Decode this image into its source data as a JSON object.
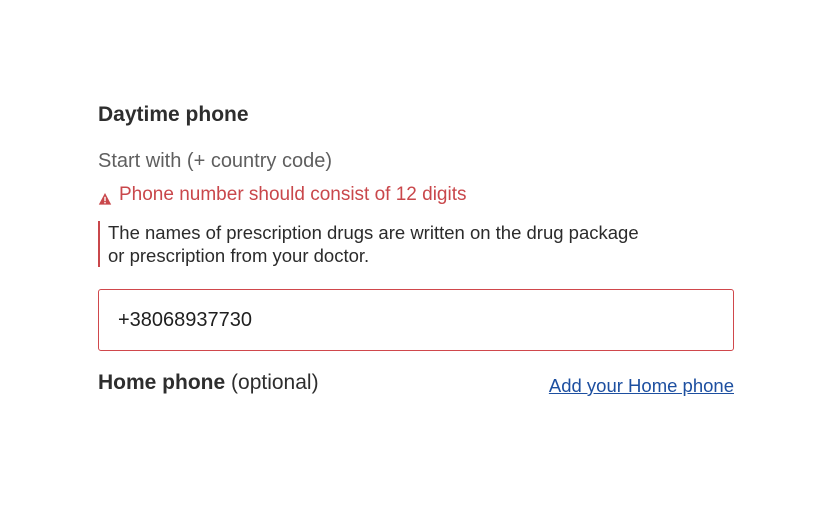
{
  "daytime_phone": {
    "title": "Daytime phone",
    "hint": "Start with (+ country code)",
    "error": {
      "icon": "warning-icon",
      "message": "Phone number should consist of 12 digits",
      "color": "#c9474b"
    },
    "note": "The names of prescription drugs are written on the drug package or prescription from your doctor.",
    "input": {
      "value": "+38068937730",
      "border_color": "#d0484c"
    }
  },
  "home_phone": {
    "label": "Home phone",
    "optional": "(optional)",
    "add_link": "Add your Home phone",
    "link_color": "#1d4fa0"
  }
}
